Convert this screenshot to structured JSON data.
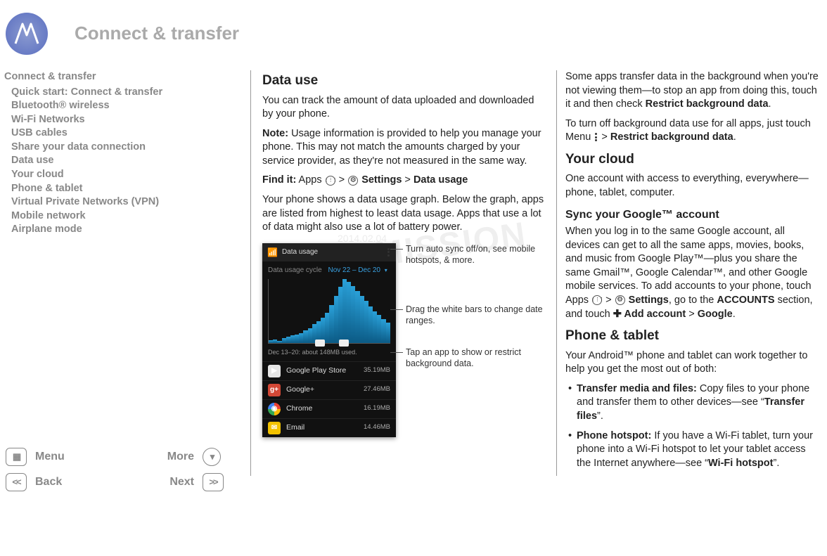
{
  "header": {
    "title": "Connect & transfer"
  },
  "watermark": {
    "main": "SUBMISSION",
    "date": "2014.02.04"
  },
  "sidebar": {
    "heading": "Connect & transfer",
    "items": [
      "Quick start: Connect & transfer",
      "Bluetooth® wireless",
      "Wi-Fi Networks",
      "USB cables",
      "Share your data connection",
      "Data use",
      "Your cloud",
      "Phone & tablet",
      "Virtual Private Networks (VPN)",
      "Mobile network",
      "Airplane mode"
    ]
  },
  "nav": {
    "menu": "Menu",
    "more": "More",
    "back": "Back",
    "next": "Next",
    "back_glyph": "<<",
    "next_glyph": ">>"
  },
  "mid": {
    "h_data_use": "Data use",
    "p_intro": "You can track the amount of data uploaded and downloaded by your phone.",
    "note_label": "Note:",
    "note_body": " Usage information is provided to help you manage your phone. This may not match the amounts charged by your service provider, as they're not measured in the same way.",
    "find_label": "Find it:",
    "find_apps": " Apps ",
    "arrow": " > ",
    "find_settings": " Settings",
    "find_data_usage": "Data usage",
    "p_graph": "Your phone shows a data usage graph. Below the graph, apps are listed from highest to least data usage. Apps that use a lot of data might also use a lot of battery power."
  },
  "phone": {
    "title": "Data usage",
    "cycle_label": "Data usage cycle",
    "cycle_value": "Nov 22 – Dec 20",
    "caption": "Dec 13–20: about 148MB used.",
    "apps": [
      {
        "name": "Google Play Store",
        "size": "35.19MB",
        "color": "#fff",
        "bg": "#e6e6e6",
        "glyph": "▶"
      },
      {
        "name": "Google+",
        "size": "27.46MB",
        "color": "#fff",
        "bg": "#d34836",
        "glyph": "g+"
      },
      {
        "name": "Chrome",
        "size": "16.19MB",
        "color": "#fff",
        "bg": "linear",
        "glyph": "◉"
      },
      {
        "name": "Email",
        "size": "14.46MB",
        "color": "#fff",
        "bg": "#f2c200",
        "glyph": "✉"
      }
    ]
  },
  "callouts": {
    "c1": "Turn auto sync off/on, see mobile hotspots, & more.",
    "c2": "Drag the white bars to change date ranges.",
    "c3": "Tap an app to show or restrict background data."
  },
  "right": {
    "p_bg1": "Some apps transfer data in the background when you're not viewing them—to stop an app from doing this, touch it and then check ",
    "p_bg1_b": "Restrict background data",
    "p_bg1_end": ".",
    "p_bg2a": "To turn off background data use for all apps, just touch Menu ",
    "p_bg2_arrow": " > ",
    "p_bg2_b": "Restrict background data",
    "p_bg2_end": ".",
    "h_cloud": "Your cloud",
    "p_cloud": "One account with access to everything, everywhere—phone, tablet, computer.",
    "h_sync": "Sync your Google™ account",
    "p_sync1": "When you log in to the same Google account, all devices can get to all the same apps, movies, books, and music from Google Play™—plus you share the same Gmail™, Google Calendar™, and other Google mobile services. To add accounts to your phone, touch Apps ",
    "p_sync_settings": " Settings",
    "p_sync2": ", go to the ",
    "p_sync_accounts": "ACCOUNTS",
    "p_sync3": " section, and touch ",
    "p_sync_add": " Add account",
    "p_sync_arrow": " > ",
    "p_sync_google": "Google",
    "p_sync_end": ".",
    "h_pt": "Phone & tablet",
    "p_pt": "Your Android™ phone and tablet can work together to help you get the most out of both:",
    "li1_b": "Transfer media and files:",
    "li1": " Copy files to your phone and transfer them to other devices—see “",
    "li1_link": "Transfer files",
    "li1_end": "”.",
    "li2_b": "Phone hotspot:",
    "li2": " If you have a Wi-Fi tablet, turn your phone into a Wi-Fi hotspot to let your tablet access the Internet anywhere—see “",
    "li2_link": "Wi-Fi hotspot",
    "li2_end": "”."
  },
  "chart_data": {
    "type": "bar",
    "title": "Data usage",
    "x_range": "Nov 22 – Dec 20",
    "summary": "Dec 13–20: about 148MB used.",
    "bars_relative_heights": [
      5,
      6,
      4,
      8,
      10,
      12,
      14,
      16,
      20,
      24,
      30,
      34,
      40,
      48,
      60,
      74,
      88,
      100,
      96,
      90,
      82,
      74,
      66,
      58,
      50,
      44,
      38,
      32
    ]
  }
}
